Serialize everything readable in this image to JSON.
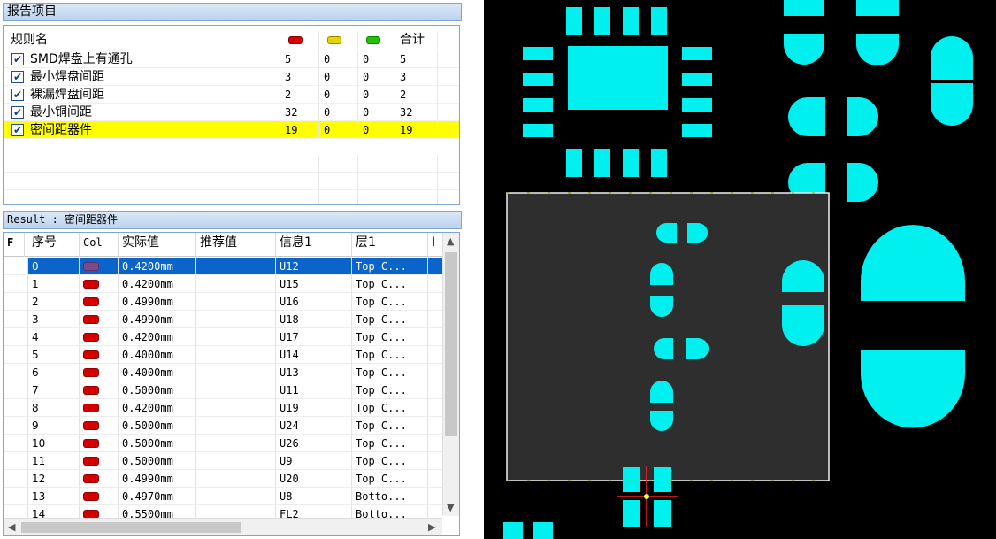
{
  "report_section": {
    "title": "报告项目"
  },
  "rules_table": {
    "headers": {
      "name": "规则名",
      "total": "合计"
    },
    "status_colors": {
      "error": "#d90000",
      "warning": "#e5d400",
      "ok": "#1ec400"
    },
    "rows": [
      {
        "name": "SMD焊盘上有通孔",
        "red": "5",
        "yellow": "0",
        "green": "0",
        "total": "5",
        "checked": true,
        "highlight": false
      },
      {
        "name": "最小焊盘间距",
        "red": "3",
        "yellow": "0",
        "green": "0",
        "total": "3",
        "checked": true,
        "highlight": false
      },
      {
        "name": "裸漏焊盘间距",
        "red": "2",
        "yellow": "0",
        "green": "0",
        "total": "2",
        "checked": true,
        "highlight": false
      },
      {
        "name": "最小铜间距",
        "red": "32",
        "yellow": "0",
        "green": "0",
        "total": "32",
        "checked": true,
        "highlight": false
      },
      {
        "name": "密间距器件",
        "red": "19",
        "yellow": "0",
        "green": "0",
        "total": "19",
        "checked": true,
        "highlight": true
      }
    ]
  },
  "result_section": {
    "title": "Result : 密间距器件"
  },
  "result_table": {
    "headers": {
      "f": "F",
      "index": "序号",
      "col": "Col",
      "actual": "实际值",
      "recommended": "推荐值",
      "info": "信息1",
      "layer": "层1",
      "more": "I"
    },
    "rows": [
      {
        "index": "0",
        "color": "#7c4a8c",
        "actual": "0.4200mm",
        "recommended": "",
        "info": "U12",
        "layer": "Top C...",
        "selected": true
      },
      {
        "index": "1",
        "color": "#d40000",
        "actual": "0.4200mm",
        "recommended": "",
        "info": "U15",
        "layer": "Top C...",
        "selected": false
      },
      {
        "index": "2",
        "color": "#d40000",
        "actual": "0.4990mm",
        "recommended": "",
        "info": "U16",
        "layer": "Top C...",
        "selected": false
      },
      {
        "index": "3",
        "color": "#d40000",
        "actual": "0.4990mm",
        "recommended": "",
        "info": "U18",
        "layer": "Top C...",
        "selected": false
      },
      {
        "index": "4",
        "color": "#d40000",
        "actual": "0.4200mm",
        "recommended": "",
        "info": "U17",
        "layer": "Top C...",
        "selected": false
      },
      {
        "index": "5",
        "color": "#d40000",
        "actual": "0.4000mm",
        "recommended": "",
        "info": "U14",
        "layer": "Top C...",
        "selected": false
      },
      {
        "index": "6",
        "color": "#d40000",
        "actual": "0.4000mm",
        "recommended": "",
        "info": "U13",
        "layer": "Top C...",
        "selected": false
      },
      {
        "index": "7",
        "color": "#d40000",
        "actual": "0.5000mm",
        "recommended": "",
        "info": "U11",
        "layer": "Top C...",
        "selected": false
      },
      {
        "index": "8",
        "color": "#d40000",
        "actual": "0.4200mm",
        "recommended": "",
        "info": "U19",
        "layer": "Top C...",
        "selected": false
      },
      {
        "index": "9",
        "color": "#d40000",
        "actual": "0.5000mm",
        "recommended": "",
        "info": "U24",
        "layer": "Top C...",
        "selected": false
      },
      {
        "index": "10",
        "color": "#d40000",
        "actual": "0.5000mm",
        "recommended": "",
        "info": "U26",
        "layer": "Top C...",
        "selected": false
      },
      {
        "index": "11",
        "color": "#d40000",
        "actual": "0.5000mm",
        "recommended": "",
        "info": "U9",
        "layer": "Top C...",
        "selected": false
      },
      {
        "index": "12",
        "color": "#d40000",
        "actual": "0.4990mm",
        "recommended": "",
        "info": "U20",
        "layer": "Top C...",
        "selected": false
      },
      {
        "index": "13",
        "color": "#d40000",
        "actual": "0.4970mm",
        "recommended": "",
        "info": "U8",
        "layer": "Botto...",
        "selected": false
      },
      {
        "index": "14",
        "color": "#d40000",
        "actual": "0.5500mm",
        "recommended": "",
        "info": "FL2",
        "layer": "Botto...",
        "selected": false
      }
    ]
  },
  "pcb_view": {
    "background": "#000000",
    "pad_color": "#00f0f0",
    "selection_fill": "#2e2e2e",
    "selection_border": "#f0f0f0",
    "cursor_color": "#ff2020",
    "marker_color": "#ffff40"
  }
}
